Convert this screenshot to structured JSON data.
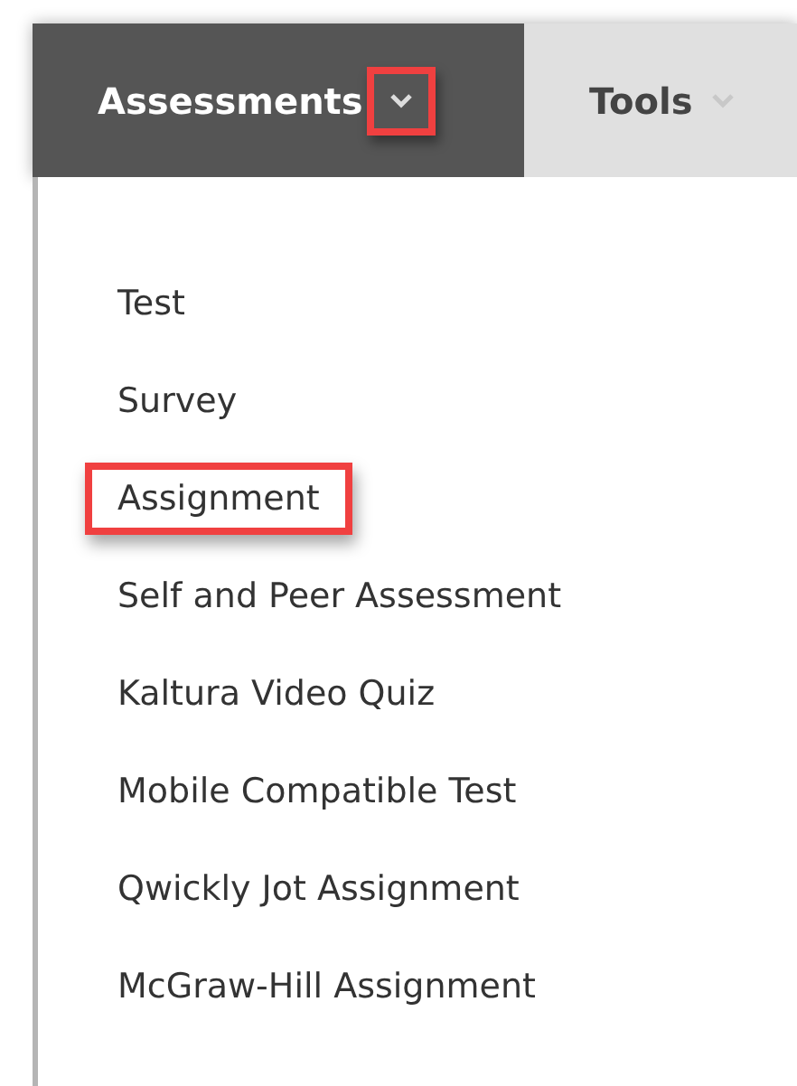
{
  "tabs": [
    {
      "label": "Assessments",
      "selected": true,
      "caret_highlighted": true
    },
    {
      "label": "Tools",
      "selected": false,
      "caret_highlighted": false
    }
  ],
  "menu": {
    "items": [
      {
        "label": "Test",
        "highlighted": false
      },
      {
        "label": "Survey",
        "highlighted": false
      },
      {
        "label": "Assignment",
        "highlighted": true
      },
      {
        "label": "Self and Peer Assessment",
        "highlighted": false
      },
      {
        "label": "Kaltura Video Quiz",
        "highlighted": false
      },
      {
        "label": "Mobile Compatible Test",
        "highlighted": false
      },
      {
        "label": "Qwickly Jot Assignment",
        "highlighted": false
      },
      {
        "label": "McGraw-Hill Assignment",
        "highlighted": false
      }
    ]
  }
}
